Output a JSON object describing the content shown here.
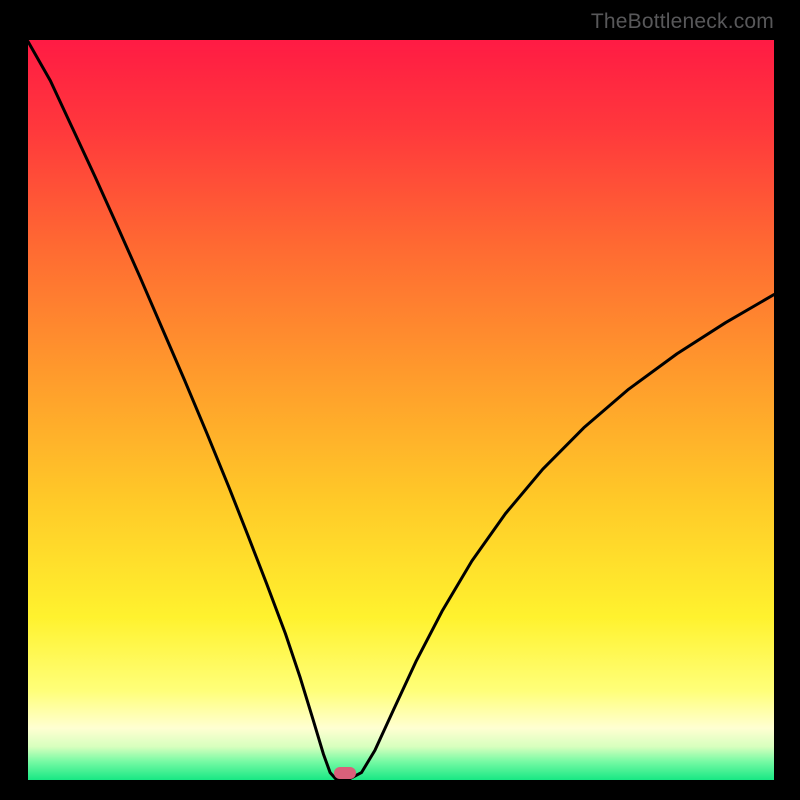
{
  "watermark": "TheBottleneck.com",
  "colors": {
    "frame": "#000000",
    "watermark": "#58585a",
    "curve": "#000000",
    "marker": "#d9607a",
    "gradient_stops": [
      {
        "offset": 0.0,
        "color": "#ff1b44"
      },
      {
        "offset": 0.12,
        "color": "#ff383c"
      },
      {
        "offset": 0.28,
        "color": "#ff6a32"
      },
      {
        "offset": 0.45,
        "color": "#ff9a2c"
      },
      {
        "offset": 0.62,
        "color": "#ffc928"
      },
      {
        "offset": 0.78,
        "color": "#fff22e"
      },
      {
        "offset": 0.88,
        "color": "#ffff7a"
      },
      {
        "offset": 0.93,
        "color": "#ffffd2"
      },
      {
        "offset": 0.955,
        "color": "#d7ffbe"
      },
      {
        "offset": 0.975,
        "color": "#77faa4"
      },
      {
        "offset": 1.0,
        "color": "#18e884"
      }
    ]
  },
  "chart_data": {
    "type": "line",
    "title": "",
    "xlabel": "",
    "ylabel": "",
    "xlim": [
      0,
      1
    ],
    "ylim": [
      0,
      1
    ],
    "x_minimum": 0.413,
    "series": [
      {
        "name": "bottleneck-curve",
        "points": [
          {
            "x": 0.0,
            "y": 0.998
          },
          {
            "x": 0.03,
            "y": 0.945
          },
          {
            "x": 0.06,
            "y": 0.88
          },
          {
            "x": 0.09,
            "y": 0.815
          },
          {
            "x": 0.12,
            "y": 0.748
          },
          {
            "x": 0.15,
            "y": 0.68
          },
          {
            "x": 0.18,
            "y": 0.61
          },
          {
            "x": 0.21,
            "y": 0.54
          },
          {
            "x": 0.24,
            "y": 0.468
          },
          {
            "x": 0.27,
            "y": 0.394
          },
          {
            "x": 0.295,
            "y": 0.33
          },
          {
            "x": 0.32,
            "y": 0.265
          },
          {
            "x": 0.345,
            "y": 0.198
          },
          {
            "x": 0.365,
            "y": 0.138
          },
          {
            "x": 0.382,
            "y": 0.082
          },
          {
            "x": 0.396,
            "y": 0.035
          },
          {
            "x": 0.405,
            "y": 0.01
          },
          {
            "x": 0.413,
            "y": 0.001
          },
          {
            "x": 0.43,
            "y": 0.001
          },
          {
            "x": 0.447,
            "y": 0.01
          },
          {
            "x": 0.465,
            "y": 0.04
          },
          {
            "x": 0.49,
            "y": 0.095
          },
          {
            "x": 0.52,
            "y": 0.16
          },
          {
            "x": 0.555,
            "y": 0.228
          },
          {
            "x": 0.595,
            "y": 0.296
          },
          {
            "x": 0.64,
            "y": 0.36
          },
          {
            "x": 0.69,
            "y": 0.42
          },
          {
            "x": 0.745,
            "y": 0.476
          },
          {
            "x": 0.805,
            "y": 0.528
          },
          {
            "x": 0.87,
            "y": 0.576
          },
          {
            "x": 0.935,
            "y": 0.618
          },
          {
            "x": 1.0,
            "y": 0.656
          }
        ]
      }
    ],
    "marker": {
      "x": 0.425,
      "y": 0.005
    }
  }
}
